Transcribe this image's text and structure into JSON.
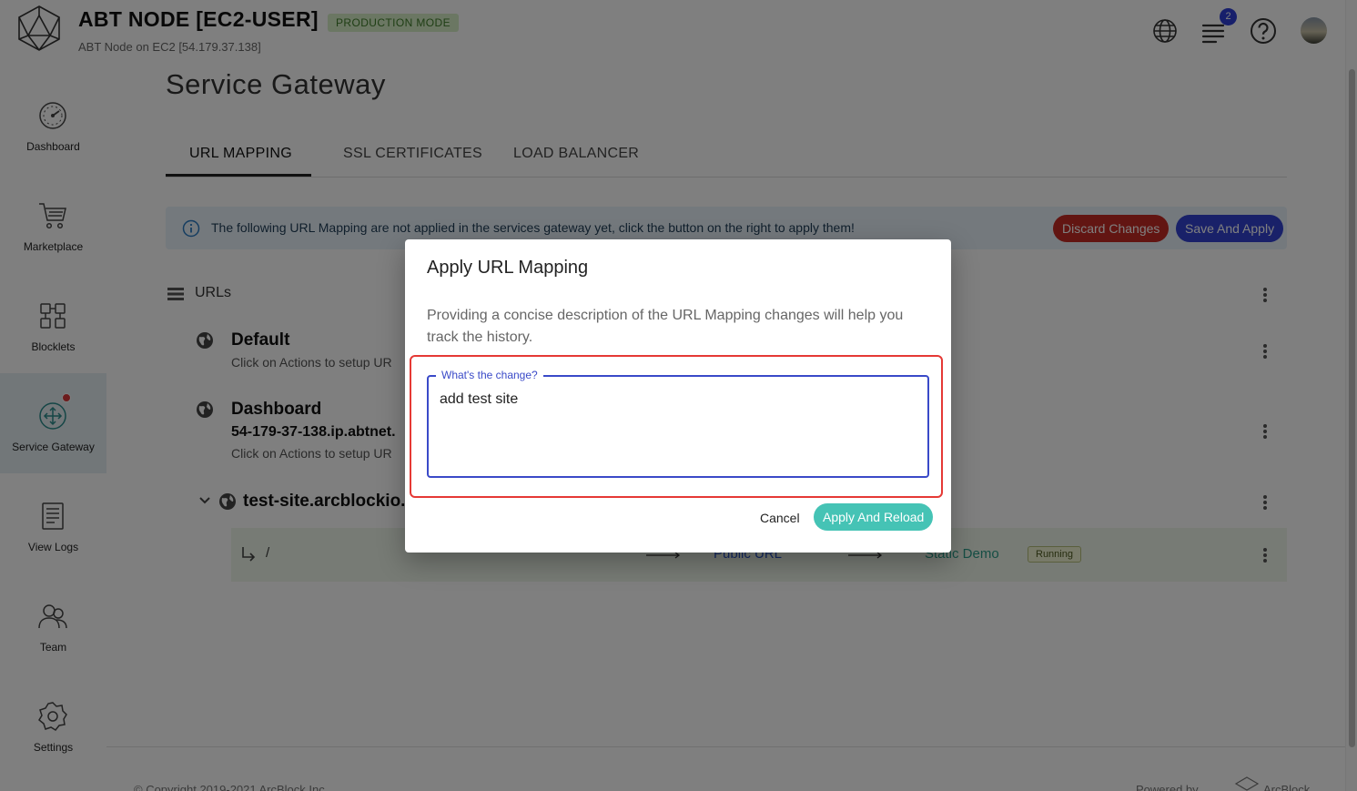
{
  "header": {
    "title": "ABT NODE [EC2-USER]",
    "mode_badge": "PRODUCTION MODE",
    "subtitle": "ABT Node on EC2 [54.179.37.138]",
    "notifications_count": "2"
  },
  "sidebar": {
    "items": [
      {
        "label": "Dashboard",
        "icon": "dashboard-icon"
      },
      {
        "label": "Marketplace",
        "icon": "cart-icon"
      },
      {
        "label": "Blocklets",
        "icon": "blocklets-icon"
      },
      {
        "label": "Service Gateway",
        "icon": "gateway-icon",
        "active": true
      },
      {
        "label": "View Logs",
        "icon": "logs-icon"
      },
      {
        "label": "Team",
        "icon": "team-icon"
      },
      {
        "label": "Settings",
        "icon": "settings-icon"
      }
    ]
  },
  "main": {
    "page_title": "Service Gateway",
    "tabs": [
      {
        "label": "URL MAPPING",
        "active": true
      },
      {
        "label": "SSL CERTIFICATES"
      },
      {
        "label": "LOAD BALANCER"
      }
    ],
    "info_bar": {
      "text": "The following URL Mapping are not applied in the services gateway yet, click the button on the right to apply them!",
      "discard_label": "Discard Changes",
      "save_label": "Save And Apply"
    },
    "urls_title": "URLs",
    "sites": [
      {
        "name": "Default",
        "domain": "",
        "hint": "Click on Actions to setup UR"
      },
      {
        "name": "Dashboard",
        "domain": "54-179-37-138.ip.abtnet.",
        "hint": "Click on Actions to setup UR"
      },
      {
        "name": "test-site.arcblockio."
      }
    ],
    "rule": {
      "path": "/",
      "target": "Public URL",
      "service": "Static Demo",
      "status": "Running"
    }
  },
  "footer": {
    "copyright": "© Copyright 2019-2021 ArcBlock Inc.",
    "powered": "Powered by",
    "brand": "ArcBlock"
  },
  "dialog": {
    "title": "Apply URL Mapping",
    "description": "Providing a concise description of the URL Mapping changes will help you track the history.",
    "field_label": "What's the change?",
    "field_value": "add test site",
    "cancel_label": "Cancel",
    "apply_label": "Apply And Reload"
  },
  "colors": {
    "accent": "#3343d2",
    "danger": "#c52a24",
    "primary_button": "#45c3b5",
    "highlight": "#e53935"
  }
}
